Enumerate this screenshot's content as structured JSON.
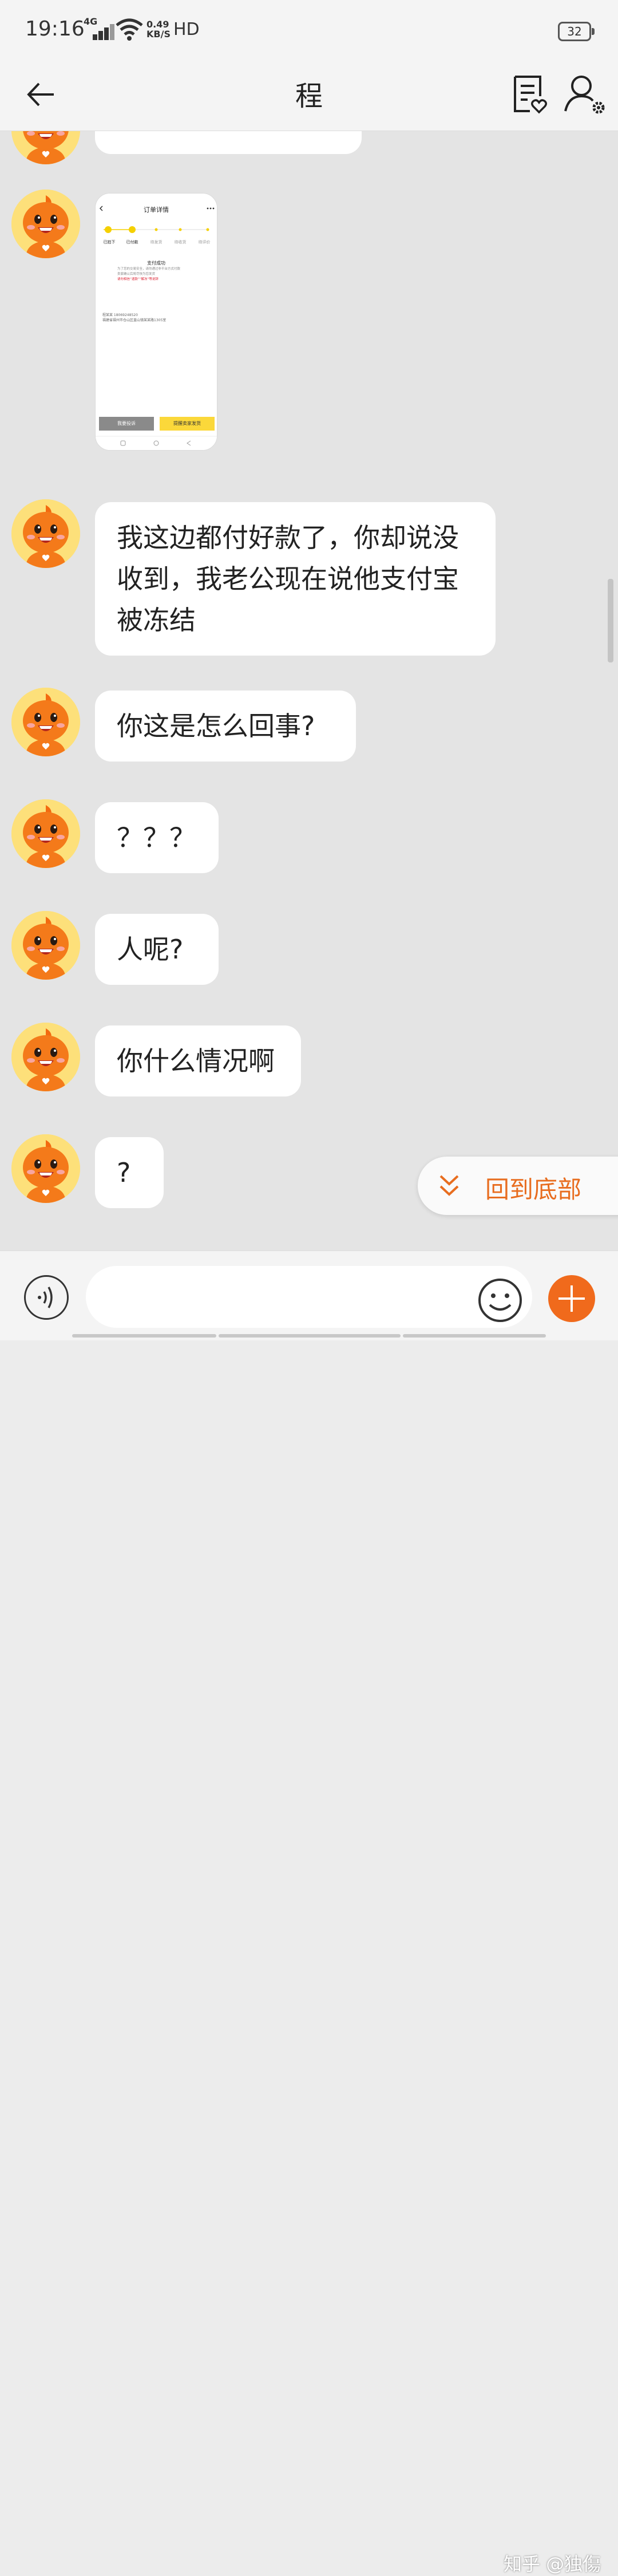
{
  "status_bar": {
    "time": "19:16",
    "network": "4G",
    "speed_value": "0.49",
    "speed_unit": "KB/S",
    "hd": "HD",
    "battery": "32"
  },
  "header": {
    "title": "程",
    "back_icon": "back-arrow-icon",
    "notes_icon": "order-notes-icon",
    "profile_icon": "user-settings-icon"
  },
  "thumbnail": {
    "title": "订单详情",
    "steps": [
      "已拍下",
      "已付款",
      "待发货",
      "待收货",
      "待评价"
    ],
    "status": "支付成功",
    "line1": "为了您的交易安全，请勿通过非平台方式付款",
    "line2": "卖家确认后将尽快为您发货",
    "line3": "请勿相信“退款”“解冻”等说辞",
    "contact": "程某某 18069248520",
    "address": "福建省福州市仓山区盖山镇某某路1305室",
    "btn_complain": "我要投诉",
    "btn_remind": "提醒卖家发货"
  },
  "messages": [
    {
      "type": "image"
    },
    {
      "type": "text",
      "text": "我这边都付好款了，你却说没收到，我老公现在说他支付宝被冻结"
    },
    {
      "type": "text",
      "text": "你这是怎么回事?"
    },
    {
      "type": "text",
      "text": "？？？"
    },
    {
      "type": "text",
      "text": "人呢?"
    },
    {
      "type": "text",
      "text": "你什么情况啊"
    },
    {
      "type": "text",
      "text": "?"
    }
  ],
  "scroll_to_bottom": {
    "label": "回到底部",
    "icon": "double-chevron-down-icon"
  },
  "input_bar": {
    "voice_icon": "voice-icon",
    "input_placeholder": "",
    "emoji_icon": "emoji-icon",
    "plus_icon": "plus-icon"
  },
  "watermark": "知乎 @独傷",
  "colors": {
    "accent": "#f06a1c",
    "background": "#e4e4e4",
    "bubble": "#ffffff",
    "avatar_bg": "#fde07a"
  }
}
